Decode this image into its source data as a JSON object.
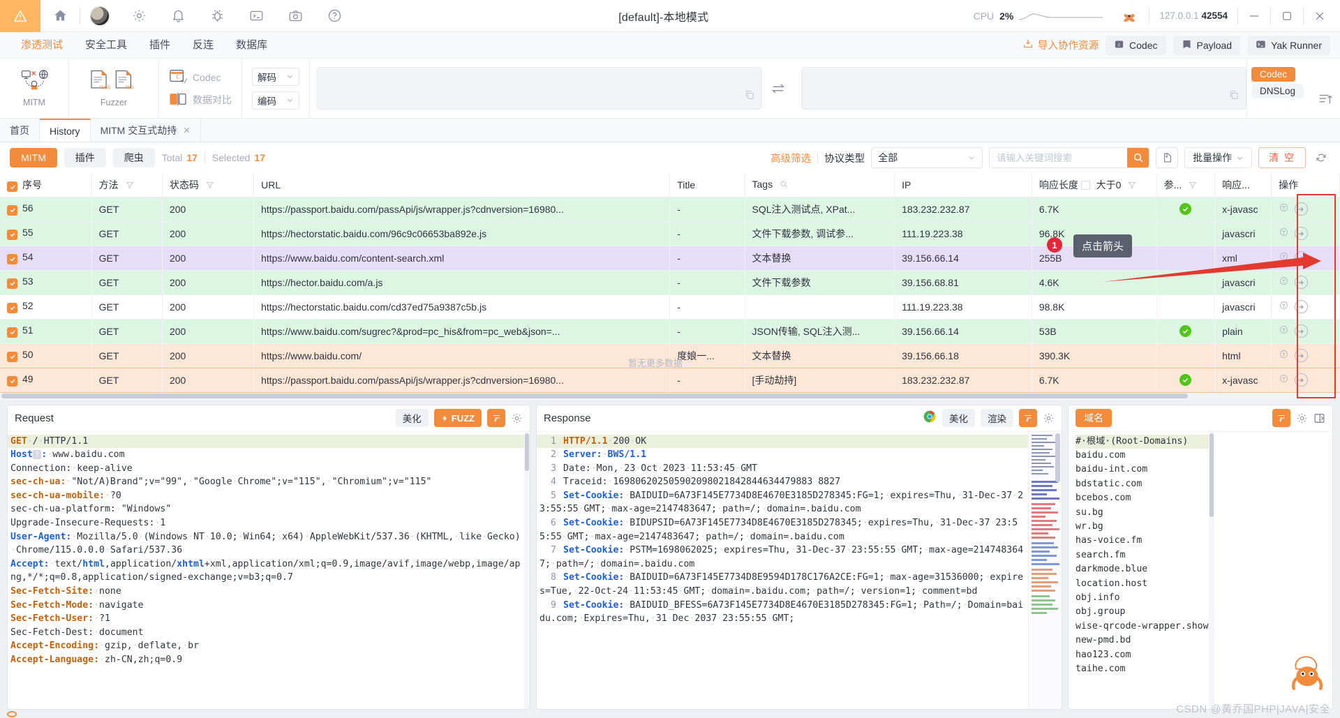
{
  "titlebar": {
    "title": "[default]-本地模式",
    "cpu_label": "CPU",
    "cpu_value": "2%",
    "addr_ip": "127.0.0.1",
    "addr_port": "42554",
    "icons": [
      "warning-icon",
      "home-icon",
      "avatar",
      "gear-icon",
      "bell-icon",
      "bug-icon",
      "terminal-icon",
      "camera-icon",
      "help-icon"
    ],
    "minimize": "—",
    "maximize": "□",
    "close": "✕"
  },
  "menustrip": {
    "items": [
      {
        "label": "渗透测试",
        "active": true
      },
      {
        "label": "安全工具",
        "active": false
      },
      {
        "label": "插件",
        "active": false
      },
      {
        "label": "反连",
        "active": false
      },
      {
        "label": "数据库",
        "active": false
      }
    ],
    "import_label": "导入协作资源",
    "chips": [
      "Codec",
      "Payload",
      "Yak Runner"
    ]
  },
  "ribbon": {
    "tools": [
      {
        "label": "MITM",
        "icon": "mitm-icon"
      },
      {
        "label": "Fuzzer",
        "icon": "fuzzer-icon"
      }
    ],
    "codec_label": "Codec",
    "datacompare_label": "数据对比",
    "decode_label": "解码",
    "encode_label": "编码",
    "side_tabs": [
      {
        "label": "Codec",
        "active": true
      },
      {
        "label": "DNSLog",
        "active": false
      }
    ]
  },
  "pagetabs": [
    {
      "label": "首页",
      "active": false,
      "closable": false
    },
    {
      "label": "History",
      "active": true,
      "closable": false
    },
    {
      "label": "MITM 交互式劫持",
      "active": false,
      "closable": true
    }
  ],
  "filterbar": {
    "pills": [
      {
        "label": "MITM",
        "active": true
      },
      {
        "label": "插件",
        "active": false
      },
      {
        "label": "爬虫",
        "active": false
      }
    ],
    "total_label": "Total",
    "total_value": "17",
    "selected_label": "Selected",
    "selected_value": "17",
    "advanced_filter": "高级筛选",
    "protocol_label": "协议类型",
    "protocol_value": "全部",
    "search_placeholder": "请输入关键词搜索",
    "search_value": "",
    "batch_label": "批量操作",
    "clear_label": "清 空"
  },
  "table": {
    "columns": [
      "序号",
      "方法",
      "状态码",
      "URL",
      "Title",
      "Tags",
      "IP",
      "响应长度",
      "参...",
      "响应...",
      "操作"
    ],
    "col_greater_label": "大于0",
    "rows": [
      {
        "id": "56",
        "method": "GET",
        "code": "200",
        "url": "https://passport.baidu.com/passApi/js/wrapper.js?cdnversion=16980...",
        "title": "-",
        "tags": "SQL注入测试点, XPat...",
        "ip": "183.232.232.87",
        "size": "6.7K",
        "ok": true,
        "type": "x-javasc",
        "color": "g"
      },
      {
        "id": "55",
        "method": "GET",
        "code": "200",
        "url": "https://hectorstatic.baidu.com/96c9c06653ba892e.js",
        "title": "-",
        "tags": "文件下载参数, 调试参...",
        "ip": "111.19.223.38",
        "size": "96.8K",
        "ok": false,
        "type": "javascri",
        "color": "g"
      },
      {
        "id": "54",
        "method": "GET",
        "code": "200",
        "url": "https://www.baidu.com/content-search.xml",
        "title": "-",
        "tags": "文本替换",
        "ip": "39.156.66.14",
        "size": "255B",
        "ok": false,
        "type": "xml",
        "color": "v"
      },
      {
        "id": "53",
        "method": "GET",
        "code": "200",
        "url": "https://hector.baidu.com/a.js",
        "title": "-",
        "tags": "文件下载参数",
        "ip": "39.156.68.81",
        "size": "4.6K",
        "ok": false,
        "type": "javascri",
        "color": "g"
      },
      {
        "id": "52",
        "method": "GET",
        "code": "200",
        "url": "https://hectorstatic.baidu.com/cd37ed75a9387c5b.js",
        "title": "-",
        "tags": "",
        "ip": "111.19.223.38",
        "size": "98.8K",
        "ok": false,
        "type": "javascri",
        "color": "w"
      },
      {
        "id": "51",
        "method": "GET",
        "code": "200",
        "url": "https://www.baidu.com/sugrec?&prod=pc_his&from=pc_web&json=...",
        "title": "-",
        "tags": "JSON传输, SQL注入测...",
        "ip": "39.156.66.14",
        "size": "53B",
        "ok": true,
        "type": "plain",
        "color": "g"
      },
      {
        "id": "50",
        "method": "GET",
        "code": "200",
        "url": "https://www.baidu.com/",
        "title": "度娘一...",
        "tags": "文本替换",
        "ip": "39.156.66.18",
        "size": "390.3K",
        "ok": false,
        "type": "html",
        "color": "o"
      },
      {
        "id": "49",
        "method": "GET",
        "code": "200",
        "url": "https://passport.baidu.com/passApi/js/wrapper.js?cdnversion=16980...",
        "title": "-",
        "tags": "[手动劫持]",
        "ip": "183.232.232.87",
        "size": "6.7K",
        "ok": true,
        "type": "x-javasc",
        "color": "o"
      }
    ],
    "no_more_data": "暂无更多数据",
    "callout_number": "1",
    "callout_text": "点击箭头"
  },
  "request_panel": {
    "title": "Request",
    "beautify_label": "美化",
    "fuzz_label": "FUZZ",
    "lines": [
      {
        "type": "hl",
        "html": "<span class='k-o'>GET</span><span class='dot'>·</span>/<span class='dot'>·</span>HTTP/1.1"
      },
      {
        "type": "n",
        "html": "<span class='k-b'>Host</span><span class='host-q'>?</span><span class='k-b'>:</span><span class='dot'>·</span>www.baidu.com"
      },
      {
        "type": "n",
        "html": "Connection:<span class='dot'>·</span>keep-alive"
      },
      {
        "type": "n",
        "html": "<span class='k-o'>sec-ch-ua:</span><span class='dot'>·</span>\"Not/A)Brand\";v=\"99\",<span class='dot'>·</span>\"Google<span class='dot'>·</span>Chrome\";v=\"115\",<span class='dot'>·</span>\"Chromium\";v=\"115\""
      },
      {
        "type": "n",
        "html": "<span class='k-o'>sec-ch-ua-mobile:</span><span class='dot'>·</span>?0"
      },
      {
        "type": "n",
        "html": "sec-ch-ua-platform:<span class='dot'>·</span>\"Windows\""
      },
      {
        "type": "n",
        "html": "Upgrade-Insecure-Requests:<span class='dot'>·</span>1"
      },
      {
        "type": "n",
        "html": "<span class='k-b'>User-Agent:</span><span class='dot'>·</span>Mozilla/5.0<span class='dot'>·</span>(Windows<span class='dot'>·</span>NT<span class='dot'>·</span>10.0;<span class='dot'>·</span>Win64;<span class='dot'>·</span>x64)<span class='dot'>·</span>AppleWebKit/537.36<span class='dot'>·</span>(KHTML,<span class='dot'>·</span>like<span class='dot'>·</span>Gecko)<span class='dot'>·</span>Chrome/115.0.0.0<span class='dot'>·</span>Safari/537.36"
      },
      {
        "type": "n",
        "html": "<span class='k-b'>Accept:</span><span class='dot'>·</span>text/<span class='k-b'>html</span>,application/<span class='k-b'>xhtml</span>+xml,application/xml;q=0.9,image/avif,image/webp,image/apng,*/*;q=0.8,application/signed-exchange;v=b3;q=0.7"
      },
      {
        "type": "n",
        "html": "<span class='k-o'>Sec-Fetch-Site:</span><span class='dot'>·</span>none"
      },
      {
        "type": "n",
        "html": "<span class='k-o'>Sec-Fetch-Mode:</span><span class='dot'>·</span>navigate"
      },
      {
        "type": "n",
        "html": "<span class='k-o'>Sec-Fetch-User:</span><span class='dot'>·</span>?1"
      },
      {
        "type": "n",
        "html": "Sec-Fetch-Dest:<span class='dot'>·</span>document"
      },
      {
        "type": "n",
        "html": "<span class='k-o'>Accept-Encoding:</span><span class='dot'>·</span>gzip,<span class='dot'>·</span>deflate,<span class='dot'>·</span>br"
      },
      {
        "type": "n",
        "html": "<span class='k-o'>Accept-Language:</span><span class='dot'>·</span>zh-CN,zh;q=0.9"
      }
    ]
  },
  "response_panel": {
    "title": "Response",
    "beautify_label": "美化",
    "render_label": "渲染",
    "lines": [
      {
        "no": "1",
        "hl": true,
        "html": "<span class='k-o'>HTTP/1.1</span><span class='dot'>·</span>200<span class='dot'>·</span>OK"
      },
      {
        "no": "2",
        "hl": false,
        "html": "<span class='k-b'>Server:</span><span class='dot'>·</span><span class='k-b'>BWS/1.1</span>"
      },
      {
        "no": "3",
        "hl": false,
        "html": "Date:<span class='dot'>·</span>Mon,<span class='dot'>·</span>23<span class='dot'>·</span>Oct<span class='dot'>·</span>2023<span class='dot'>·</span>11:53:45<span class='dot'>·</span>GMT"
      },
      {
        "no": "4",
        "hl": false,
        "html": "Traceid:<span class='dot'>·</span>169806202505902098021842844634479883 8827"
      },
      {
        "no": "5",
        "hl": false,
        "html": "<span class='k-b'>Set-Cookie:</span><span class='dot'>·</span>BAIDUID=6A73F145E7734D8E4670E3185D278345:FG=1;<span class='dot'>·</span>expires=Thu,<span class='dot'>·</span>31-Dec-37<span class='dot'>·</span>23:55:55<span class='dot'>·</span>GMT;<span class='dot'>·</span>max-age=2147483647;<span class='dot'>·</span>path=/;<span class='dot'>·</span>domain=.baidu.com"
      },
      {
        "no": "6",
        "hl": false,
        "html": "<span class='k-b'>Set-Cookie:</span><span class='dot'>·</span>BIDUPSID=6A73F145E7734D8E4670E3185D278345;<span class='dot'>·</span>expires=Thu,<span class='dot'>·</span>31-Dec-37<span class='dot'>·</span>23:55:55<span class='dot'>·</span>GMT;<span class='dot'>·</span>max-age=2147483647;<span class='dot'>·</span>path=/;<span class='dot'>·</span>domain=.baidu.com"
      },
      {
        "no": "7",
        "hl": false,
        "html": "<span class='k-b'>Set-Cookie:</span><span class='dot'>·</span>PSTM=1698062025;<span class='dot'>·</span>expires=Thu,<span class='dot'>·</span>31-Dec-37<span class='dot'>·</span>23:55:55<span class='dot'>·</span>GMT;<span class='dot'>·</span>max-age=2147483647;<span class='dot'>·</span>path=/;<span class='dot'>·</span>domain=.baidu.com"
      },
      {
        "no": "8",
        "hl": false,
        "html": "<span class='k-b'>Set-Cookie:</span><span class='dot'>·</span>BAIDUID=6A73F145E7734D8E9594D178C176A2CE:FG=1;<span class='dot'>·</span>max-age=31536000;<span class='dot'>·</span>expires=Tue,<span class='dot'>·</span>22-Oct-24<span class='dot'>·</span>11:53:45<span class='dot'>·</span>GMT;<span class='dot'>·</span>domain=.baidu.com;<span class='dot'>·</span>path=/;<span class='dot'>·</span>version=1;<span class='dot'>·</span>comment=bd"
      },
      {
        "no": "9",
        "hl": false,
        "html": "<span class='k-b'>Set-Cookie:</span><span class='dot'>·</span>BAIDUID_BFESS=6A73F145E7734D8E4670E3185D278345:FG=1;<span class='dot'>·</span>Path=/;<span class='dot'>·</span>Domain=baidu.com;<span class='dot'>·</span>Expires=Thu,<span class='dot'>·</span>31<span class='dot'>·</span>Dec<span class='dot'>·</span>2037<span class='dot'>·</span>23:55:55<span class='dot'>·</span>GMT;"
      }
    ]
  },
  "domain_panel": {
    "title": "域名",
    "header": "#·根域·(Root-Domains)",
    "domains": [
      "baidu.com",
      "baidu-int.com",
      "bdstatic.com",
      "bcebos.com",
      "su.bg",
      "wr.bg",
      "has-voice.fm",
      "search.fm",
      "darkmode.blue",
      "location.host",
      "obj.info",
      "obj.group",
      "wise-qrcode-wrapper.show",
      "new-pmd.bd",
      "hao123.com",
      "taihe.com"
    ]
  },
  "watermark": "CSDN @黄乔国PHP|JAVA|安全"
}
